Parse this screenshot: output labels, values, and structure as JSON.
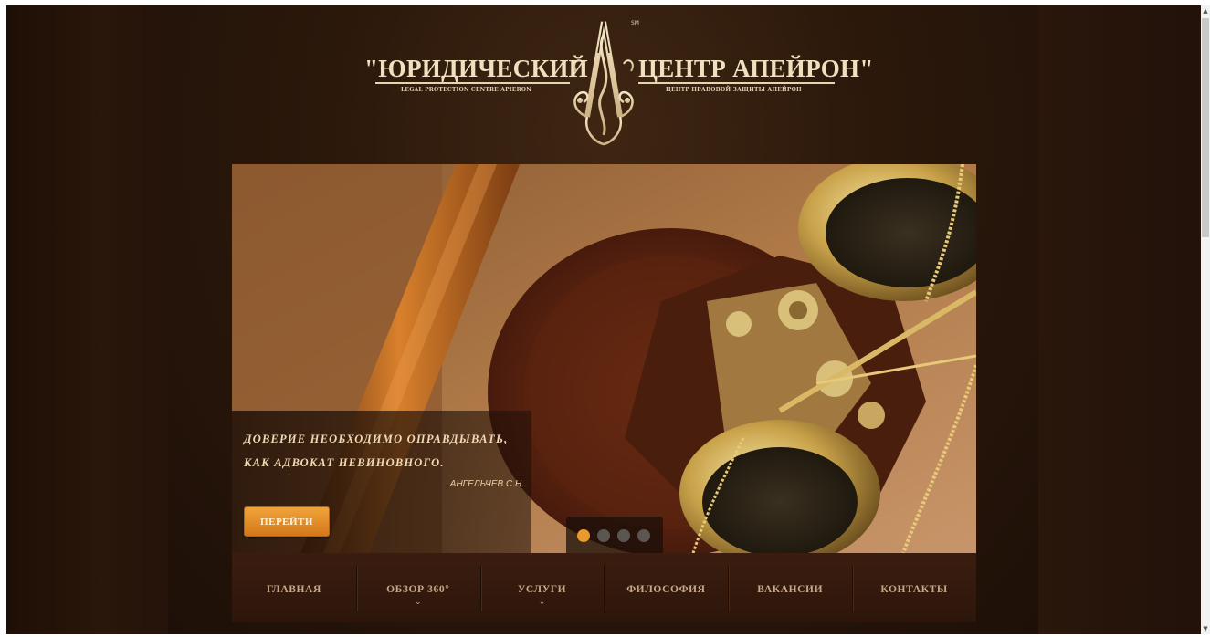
{
  "logo": {
    "left_text": "\"ЮРИДИЧЕСКИЙ",
    "right_text": "ЦЕНТР АПЕЙРОН\"",
    "left_sub": "LEGAL PROTECTION CENTRE APIERON",
    "right_sub": "ЦЕНТР ПРАВОВОЙ ЗАЩИТЫ АПЕЙРОН",
    "mark": "SM"
  },
  "slider": {
    "quote_line1": "ДОВЕРИЕ НЕОБХОДИМО ОПРАВДЫВАТЬ,",
    "quote_line2": "КАК АДВОКАТ НЕВИНОВНОГО.",
    "author": "АНГЕЛЬЧЕВ С.Н.",
    "button_label": "ПЕРЕЙТИ",
    "slide_count": 4,
    "active_slide": 1
  },
  "nav": {
    "items": [
      {
        "label": "ГЛАВНАЯ",
        "caret": ""
      },
      {
        "label": "ОБЗОР 360°",
        "caret": "⌄"
      },
      {
        "label": "УСЛУГИ",
        "caret": "⌄"
      },
      {
        "label": "ФИЛОСОФИЯ",
        "caret": ""
      },
      {
        "label": "ВАКАНСИИ",
        "caret": ""
      },
      {
        "label": "КОНТАКТЫ",
        "caret": ""
      }
    ]
  },
  "scrollbar": {
    "up_icon": "▲",
    "down_icon": "▼"
  },
  "colors": {
    "accent": "#e99a2a",
    "text_light": "#f0d9b5",
    "nav_text": "#c9a88a",
    "background": "#2b180b"
  }
}
